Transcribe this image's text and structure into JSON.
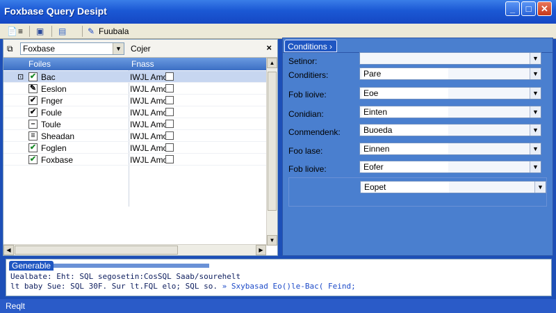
{
  "window": {
    "title": "Foxbase Query Desipt",
    "minimize": "_",
    "maximize": "□",
    "close": "✕"
  },
  "toolbar": {
    "btn1_icon": "📄",
    "btn1_text": "≡",
    "btn2_icon": "▣",
    "btn3_icon": "▤",
    "btn4_icon": "✎",
    "btn4_text": "Fuubala"
  },
  "left_panel": {
    "combo_value": "Foxbase",
    "combo_arrow": "▼",
    "label": "Cojer",
    "close": "×",
    "col_fields": "Foiles",
    "col_type": "Fnass",
    "rows": [
      {
        "name": "Bac",
        "type": "IWJL Amo",
        "checked": "✔",
        "selected": true
      },
      {
        "name": "Eeslon",
        "type": "IWJL Amo",
        "checked": "✎",
        "selected": false
      },
      {
        "name": "Fnger",
        "type": "IWJL Amo",
        "checked": "✔",
        "selected": false
      },
      {
        "name": "Foule",
        "type": "IWJL Amo",
        "checked": "✔",
        "selected": false
      },
      {
        "name": "Toule",
        "type": "IWJL Amo",
        "checked": "–",
        "selected": false
      },
      {
        "name": "Sheadan",
        "type": "IWJL Amo",
        "checked": "≡",
        "selected": false
      },
      {
        "name": "Foglen",
        "type": "IWJL Amo",
        "checked": "✔",
        "selected": false
      },
      {
        "name": "Foxbase",
        "type": "IWJL Amo",
        "checked": "✔",
        "selected": false
      }
    ]
  },
  "right_panel": {
    "tab": "Conditions  ›",
    "rows": [
      {
        "label": "Setinor:",
        "value": ""
      },
      {
        "label": "Conditiers:",
        "value": "Pare"
      },
      {
        "label": "Fob lioive:",
        "value": "Eoe"
      },
      {
        "label": "Conidian:",
        "value": "Einten"
      },
      {
        "label": "Conmendenk:",
        "value": "Buoeda"
      },
      {
        "label": "Foo lase:",
        "value": "Einnen"
      },
      {
        "label": "Fob lioive:",
        "value": "Eofer"
      }
    ],
    "extra_value": "Eopet",
    "arrow": "▼"
  },
  "generate_panel": {
    "header": "Generable",
    "line1": "Uealbate: Eht: SQL segosetin:CosSQL Saab/sourehelt",
    "line2_prefix": "lt baby Sue: SQL 30F. Sur  lt.FQL elo; SQL so.  ",
    "line2_highlight": "» Sxybasad Eo()le-Bac( Feind;"
  },
  "status": {
    "text": "Reqlt"
  }
}
